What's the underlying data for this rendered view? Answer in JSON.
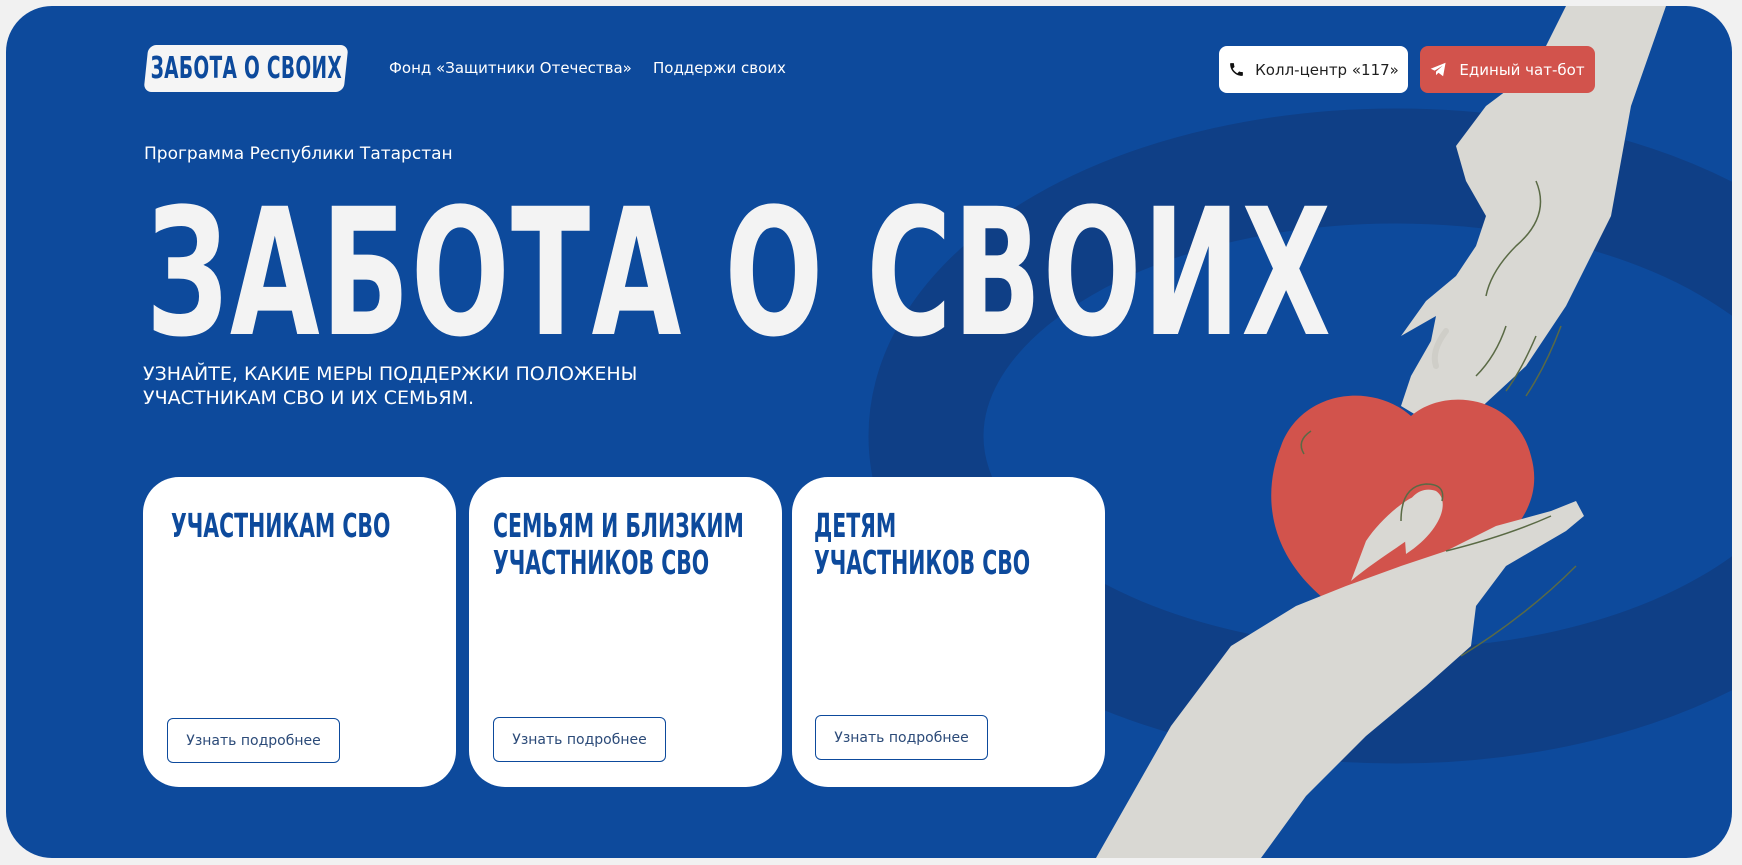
{
  "header": {
    "logo_text": "ЗАБОТА О СВОИХ",
    "nav": [
      {
        "label": "Фонд «Защитники Отечества»"
      },
      {
        "label": "Поддержи своих"
      }
    ],
    "call_center_label": "Колл-центр «117»",
    "chatbot_label": "Единый чат-бот"
  },
  "hero": {
    "program": "Программа Республики Татарстан",
    "title": "ЗАБОТА О СВОИХ",
    "subtitle_line1": "УЗНАЙТЕ, КАКИЕ МЕРЫ ПОДДЕРЖКИ ПОЛОЖЕНЫ",
    "subtitle_line2": "УЧАСТНИКАМ СВО И ИХ СЕМЬЯМ."
  },
  "cards": [
    {
      "title_line1": "УЧАСТНИКАМ СВО",
      "title_line2": "",
      "button_label": "Узнать подробнее"
    },
    {
      "title_line1": "СЕМЬЯМ И БЛИЗКИМ",
      "title_line2": "УЧАСТНИКОВ СВО",
      "button_label": "Узнать подробнее"
    },
    {
      "title_line1": "ДЕТЯМ",
      "title_line2": "УЧАСТНИКОВ СВО",
      "button_label": "Узнать подробнее"
    }
  ],
  "colors": {
    "brand_blue": "#0d4a9c",
    "accent_red": "#d2534c",
    "hand_gray": "#d9d8d3"
  },
  "icons": {
    "call": "phone-icon",
    "chatbot": "telegram-icon",
    "illustration": "hands-heart-illustration"
  }
}
